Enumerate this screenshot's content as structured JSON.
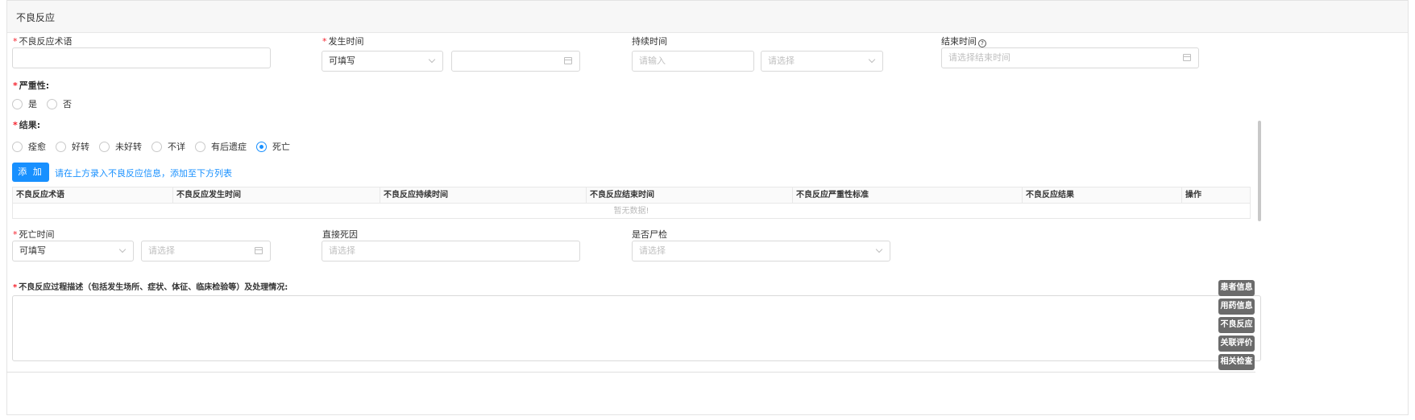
{
  "panel": {
    "title": "不良反应"
  },
  "fields": {
    "term": {
      "label": "不良反应术语",
      "value": ""
    },
    "occur_time": {
      "label": "发生时间",
      "mode_value": "可填写",
      "date_value": ""
    },
    "duration": {
      "label": "持续时间",
      "placeholder": "请输入",
      "unit_placeholder": "请选择"
    },
    "end_time": {
      "label": "结束时间",
      "help_icon": "question-circle",
      "placeholder": "请选择结束时间"
    },
    "severity": {
      "label": "严重性:",
      "options": [
        "是",
        "否"
      ],
      "selected": null
    },
    "outcome": {
      "label": "结果:",
      "options": [
        "痊愈",
        "好转",
        "未好转",
        "不详",
        "有后遗症",
        "死亡"
      ],
      "selected": "死亡"
    }
  },
  "add": {
    "button_label": "添 加",
    "hint": "请在上方录入不良反应信息，添加至下方列表"
  },
  "table": {
    "columns": [
      "不良反应术语",
      "不良反应发生时间",
      "不良反应持续时间",
      "不良反应结束时间",
      "不良反应严重性标准",
      "不良反应结果",
      "操作"
    ],
    "rows": [],
    "empty_text": "暂无数据!"
  },
  "death": {
    "time_label": "死亡时间",
    "mode_value": "可填写",
    "date_placeholder": "请选择",
    "cause_label": "直接死因",
    "cause_placeholder": "请选择",
    "autopsy_label": "是否尸检",
    "autopsy_placeholder": "请选择"
  },
  "description": {
    "label": "不良反应过程描述（包括发生场所、症状、体征、临床检验等）及处理情况:",
    "value": ""
  },
  "float_nav": [
    "患者信息",
    "用药信息",
    "不良反应",
    "关联评价",
    "相关检查"
  ],
  "colors": {
    "primary": "#1890ff",
    "required": "#f5222d",
    "float_nav_bg": "#6b6b6b"
  }
}
